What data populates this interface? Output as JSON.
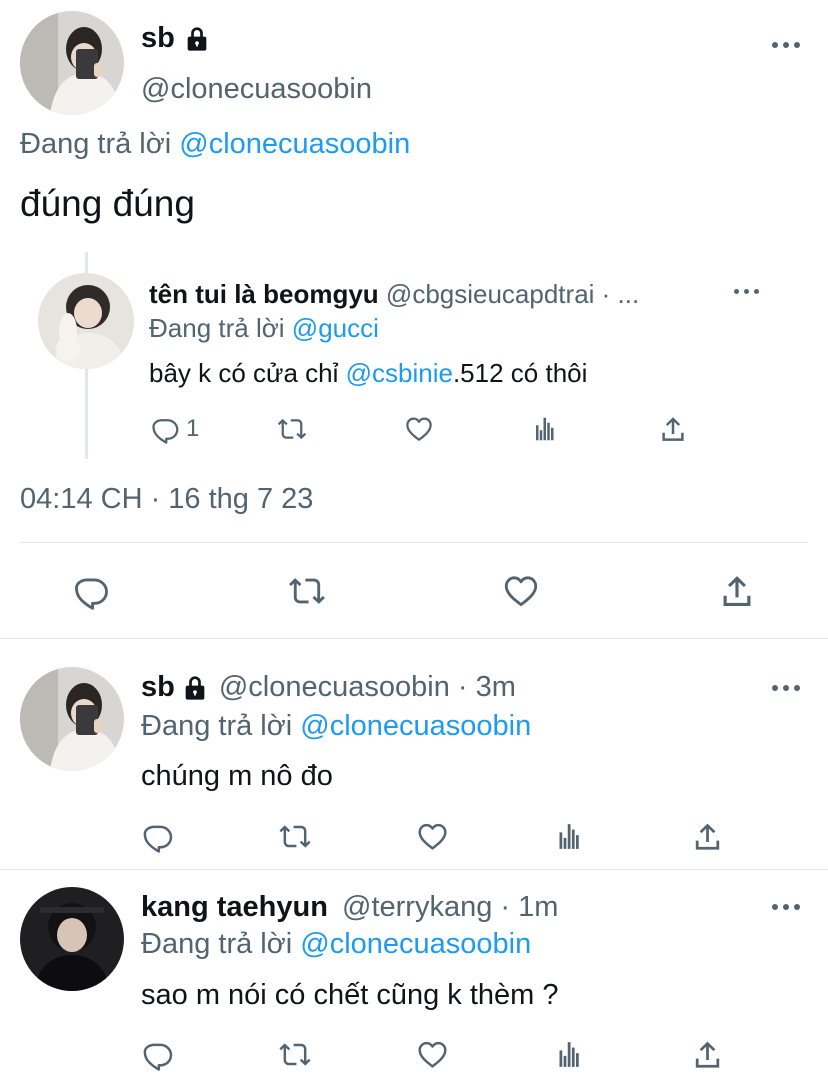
{
  "main_tweet": {
    "display_name": "sb",
    "handle": "@clonecuasoobin",
    "replying_prefix": "Đang trả lời",
    "replying_to": "@clonecuasoobin",
    "text": "đúng đúng",
    "timestamp": "04:14 CH · 16 thg 7 23",
    "quoted": {
      "display_name": "tên tui là beomgyu",
      "handle_meta": "@cbgsieucapdtrai · ...",
      "replying_prefix": "Đang trả lời",
      "replying_to": "@gucci",
      "text_before": "bây k có cửa chỉ",
      "mention": "@csbinie",
      "text_after": ".512 có thôi",
      "reply_count": "1"
    }
  },
  "replies": [
    {
      "display_name": "sb",
      "handle_meta": "@clonecuasoobin · 3m",
      "replying_prefix": "Đang trả lời",
      "replying_to": "@clonecuasoobin",
      "text": "chúng m nô đo"
    },
    {
      "display_name": "kang taehyun",
      "handle_meta": "@terrykang · 1m",
      "replying_prefix": "Đang trả lời",
      "replying_to": "@clonecuasoobin",
      "text": "sao m nói có chết cũng k thèm ?"
    }
  ],
  "colors": {
    "accent": "#1d9bf0",
    "secondary_text": "#536471",
    "divider": "#e3e7ea"
  }
}
